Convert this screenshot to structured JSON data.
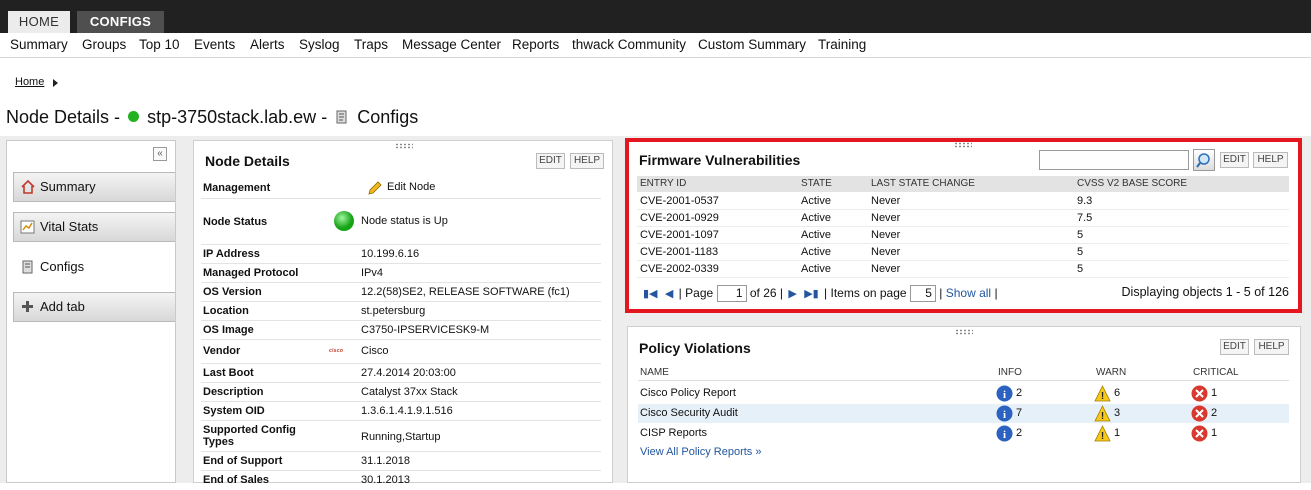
{
  "top_tabs": [
    "HOME",
    "CONFIGS"
  ],
  "menu": [
    "Summary",
    "Groups",
    "Top 10",
    "Events",
    "Alerts",
    "Syslog",
    "Traps",
    "Message Center",
    "Reports",
    "thwack Community",
    "Custom Summary",
    "Training"
  ],
  "breadcrumb": "Home",
  "page_title": {
    "prefix": "Node Details -",
    "node": "stp-3750stack.lab.ew",
    "sep": "-",
    "view": "Configs"
  },
  "sidebar": {
    "tabs": [
      "Summary",
      "Vital Stats",
      "Configs",
      "Add tab"
    ],
    "collapse": "«"
  },
  "node_details": {
    "title": "Node Details",
    "edit": "EDIT",
    "help": "HELP",
    "rows": [
      {
        "label": "Management",
        "value": "Edit Node"
      },
      {
        "label": "Node Status",
        "value": "Node status is Up"
      },
      {
        "label": "IP Address",
        "value": "10.199.6.16"
      },
      {
        "label": "Managed Protocol",
        "value": "IPv4"
      },
      {
        "label": "OS Version",
        "value": "12.2(58)SE2, RELEASE SOFTWARE (fc1)"
      },
      {
        "label": "Location",
        "value": "st.petersburg"
      },
      {
        "label": "OS Image",
        "value": "C3750-IPSERVICESK9-M"
      },
      {
        "label": "Vendor",
        "value": "Cisco"
      },
      {
        "label": "Last Boot",
        "value": "27.4.2014 20:03:00"
      },
      {
        "label": "Description",
        "value": "Catalyst 37xx Stack"
      },
      {
        "label": "System OID",
        "value": "1.3.6.1.4.1.9.1.516"
      },
      {
        "label": "Supported Config",
        "value": "Running,Startup",
        "label2": "Types"
      },
      {
        "label": "End of Support",
        "value": "31.1.2018"
      },
      {
        "label": "End of Sales",
        "value": "30.1.2013"
      }
    ],
    "vendor_logo": "cisco"
  },
  "firmware": {
    "title": "Firmware Vulnerabilities",
    "edit": "EDIT",
    "help": "HELP",
    "search_value": "",
    "columns": [
      "ENTRY ID",
      "STATE",
      "LAST STATE CHANGE",
      "CVSS V2 BASE SCORE"
    ],
    "rows": [
      [
        "CVE-2001-0537",
        "Active",
        "Never",
        "9.3"
      ],
      [
        "CVE-2001-0929",
        "Active",
        "Never",
        "7.5"
      ],
      [
        "CVE-2001-1097",
        "Active",
        "Never",
        "5"
      ],
      [
        "CVE-2001-1183",
        "Active",
        "Never",
        "5"
      ],
      [
        "CVE-2002-0339",
        "Active",
        "Never",
        "5"
      ]
    ],
    "pager": {
      "page_label": "Page",
      "page": "1",
      "of": "of 26",
      "items_label": "Items on page",
      "items": "5",
      "show_all": "Show all",
      "sep": "|",
      "displaying": "Displaying objects 1 - 5 of 126"
    }
  },
  "policy": {
    "title": "Policy Violations",
    "edit": "EDIT",
    "help": "HELP",
    "columns": [
      "NAME",
      "INFO",
      "WARN",
      "CRITICAL"
    ],
    "rows": [
      {
        "name": "Cisco Policy Report",
        "info": "2",
        "warn": "6",
        "critical": "1"
      },
      {
        "name": "Cisco Security Audit",
        "info": "7",
        "warn": "3",
        "critical": "2"
      },
      {
        "name": "CISP Reports",
        "info": "2",
        "warn": "1",
        "critical": "1"
      }
    ],
    "view_all": "View All Policy Reports »"
  },
  "colors": {
    "highlight": "#e4161f",
    "link": "#23569e",
    "status_up": "#21b121",
    "topbar": "#212121"
  }
}
